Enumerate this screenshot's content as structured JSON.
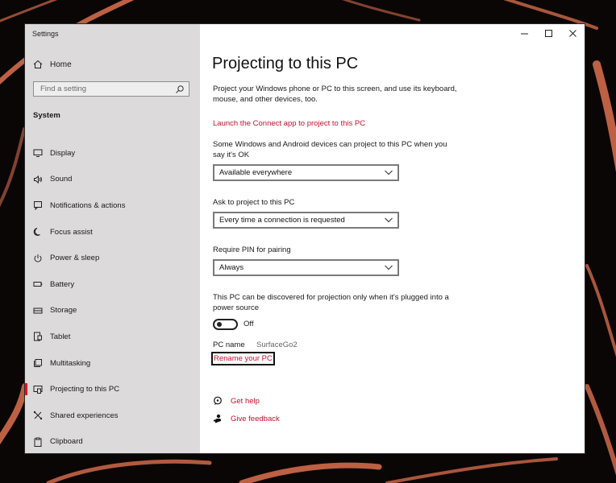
{
  "window": {
    "app_title": "Settings"
  },
  "sidebar": {
    "home_label": "Home",
    "search_placeholder": "Find a setting",
    "section_label": "System",
    "items": [
      {
        "label": "Display",
        "icon": "monitor-icon"
      },
      {
        "label": "Sound",
        "icon": "speaker-icon"
      },
      {
        "label": "Notifications & actions",
        "icon": "notifications-icon"
      },
      {
        "label": "Focus assist",
        "icon": "moon-icon"
      },
      {
        "label": "Power & sleep",
        "icon": "power-icon"
      },
      {
        "label": "Battery",
        "icon": "battery-icon"
      },
      {
        "label": "Storage",
        "icon": "storage-icon"
      },
      {
        "label": "Tablet",
        "icon": "tablet-icon"
      },
      {
        "label": "Multitasking",
        "icon": "multitasking-icon"
      },
      {
        "label": "Projecting to this PC",
        "icon": "projecting-icon",
        "active": true
      },
      {
        "label": "Shared experiences",
        "icon": "shared-icon"
      },
      {
        "label": "Clipboard",
        "icon": "clipboard-icon"
      }
    ]
  },
  "main": {
    "title": "Projecting to this PC",
    "intro": "Project your Windows phone or PC to this screen, and use its keyboard, mouse, and other devices, too.",
    "connect_link": "Launch the Connect app to project to this PC",
    "availability_text": "Some Windows and Android devices can project to this PC when you say it's OK",
    "availability_value": "Available everywhere",
    "ask_label": "Ask to project to this PC",
    "ask_value": "Every time a connection is requested",
    "pin_label": "Require PIN for pairing",
    "pin_value": "Always",
    "power_text": "This PC can be discovered for projection only when it's plugged into a power source",
    "toggle_state": "Off",
    "pc_name_label": "PC name",
    "pc_name_value": "SurfaceGo2",
    "rename_link": "Rename your PC",
    "get_help": "Get help",
    "give_feedback": "Give feedback"
  },
  "colors": {
    "accent": "#c8102e",
    "sidebar_bg": "#dcdada",
    "active_indicator": "#e81123"
  }
}
